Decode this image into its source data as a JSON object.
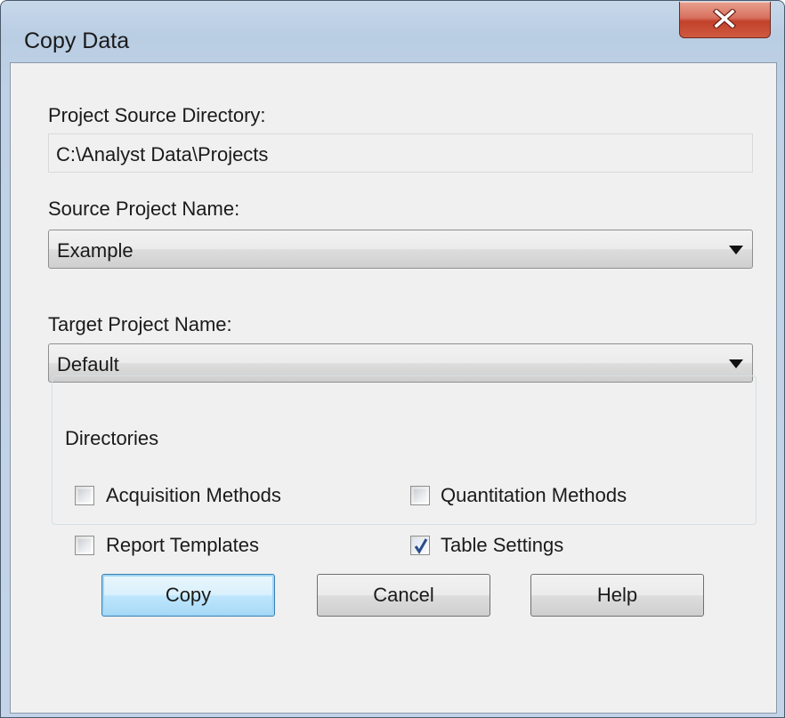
{
  "window": {
    "title": "Copy Data"
  },
  "project_source_directory": {
    "label": "Project Source Directory:",
    "value": "C:\\Analyst Data\\Projects"
  },
  "source_project": {
    "label": "Source Project Name:",
    "value": "Example"
  },
  "target_project": {
    "label": "Target Project Name:",
    "value": "Default"
  },
  "directories": {
    "label": "Directories",
    "acquisition_methods": {
      "label": "Acquisition Methods",
      "checked": false
    },
    "quantitation_methods": {
      "label": "Quantitation Methods",
      "checked": false
    },
    "report_templates": {
      "label": "Report Templates",
      "checked": false
    },
    "table_settings": {
      "label": "Table Settings",
      "checked": true
    }
  },
  "buttons": {
    "copy": "Copy",
    "cancel": "Cancel",
    "help": "Help"
  }
}
